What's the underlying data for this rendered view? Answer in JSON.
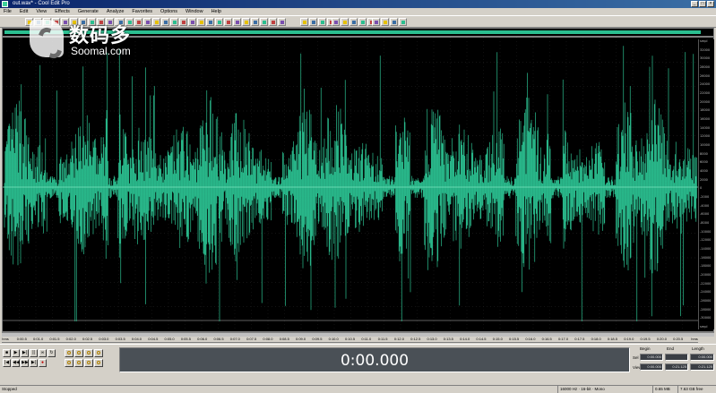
{
  "window": {
    "title": "out.wav* - Cool Edit Pro",
    "controls": [
      "_",
      "□",
      "×"
    ]
  },
  "menu": [
    "File",
    "Edit",
    "View",
    "Effects",
    "Generate",
    "Analyze",
    "Favorites",
    "Options",
    "Window",
    "Help"
  ],
  "colors": {
    "waveform": "#2bbf90",
    "background": "#000000",
    "chrome": "#d4d0c8",
    "time_display_bg": "#4a5056"
  },
  "ruler_right": [
    "smpl",
    "32000",
    "30000",
    "28000",
    "26000",
    "24000",
    "22000",
    "20000",
    "18000",
    "16000",
    "14000",
    "12000",
    "10000",
    "8000",
    "6000",
    "4000",
    "2000",
    "0",
    "-2000",
    "-4000",
    "-6000",
    "-8000",
    "-10000",
    "-12000",
    "-14000",
    "-16000",
    "-18000",
    "-20000",
    "-22000",
    "-24000",
    "-26000",
    "-28000",
    "-30000",
    "smpl"
  ],
  "timeline": [
    "hms",
    "0:00.5",
    "0:01.0",
    "0:01.5",
    "0:02.0",
    "0:02.5",
    "0:03.0",
    "0:03.5",
    "0:04.0",
    "0:04.5",
    "0:05.0",
    "0:05.5",
    "0:06.0",
    "0:06.5",
    "0:07.0",
    "0:07.5",
    "0:08.0",
    "0:08.5",
    "0:09.0",
    "0:09.5",
    "0:10.0",
    "0:10.5",
    "0:11.0",
    "0:11.5",
    "0:12.0",
    "0:12.5",
    "0:13.0",
    "0:13.5",
    "0:14.0",
    "0:14.5",
    "0:15.0",
    "0:15.5",
    "0:16.0",
    "0:16.5",
    "0:17.0",
    "0:17.5",
    "0:18.0",
    "0:18.5",
    "0:19.0",
    "0:19.5",
    "0:20.0",
    "0:20.5",
    "hms"
  ],
  "time_display": "0:00.000",
  "selection_view": {
    "headers": [
      "Begin",
      "End",
      "Length"
    ],
    "row_labels": [
      "Sel",
      "View"
    ],
    "sel": [
      "0:00.000",
      "",
      "0:00.000"
    ],
    "view": [
      "0:00.000",
      "0:21.125",
      "0:21.125"
    ]
  },
  "status": {
    "state": "Stopped",
    "sample_info": "16000 Hz · 16-bit · Mono",
    "size": "0.65 MB",
    "free": "7.63 GB free"
  },
  "watermark": {
    "cn": "数码多",
    "en": "Soomal.com"
  }
}
